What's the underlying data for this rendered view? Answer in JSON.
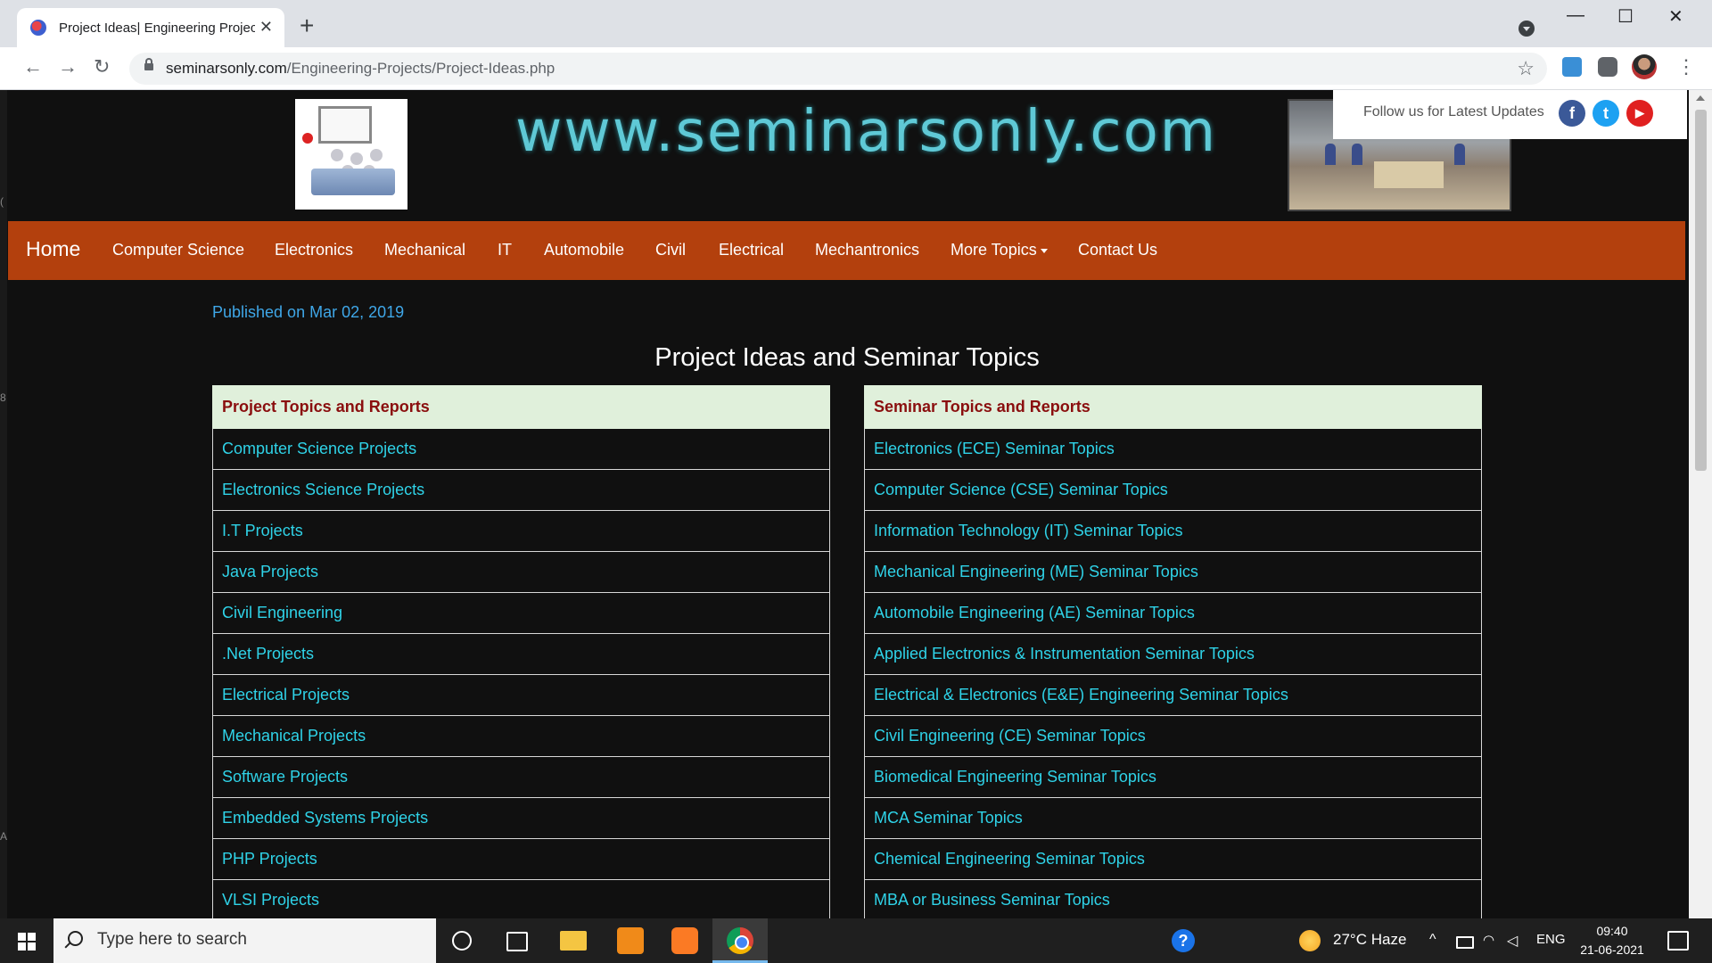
{
  "browser": {
    "tab_title": "Project Ideas| Engineering Projec",
    "new_tab": "+",
    "close_tab": "✕",
    "url_domain": "seminarsonly.com",
    "url_path": "/Engineering-Projects/Project-Ideas.php",
    "back": "←",
    "forward": "→",
    "reload": "↻",
    "star": "☆",
    "menu": "⋮",
    "minimize": "—",
    "maximize": "☐",
    "close": "✕"
  },
  "header": {
    "site_name": "www.seminarsonly.com",
    "follow_text": "Follow us for Latest Updates",
    "social": {
      "facebook": "f",
      "twitter": "t",
      "youtube": "▶"
    }
  },
  "nav": {
    "items": [
      "Home",
      "Computer Science",
      "Electronics",
      "Mechanical",
      "IT",
      "Automobile",
      "Civil",
      "Electrical",
      "Mechantronics",
      "More Topics",
      "Contact Us"
    ]
  },
  "content": {
    "published": "Published on Mar 02, 2019",
    "heading": "Project Ideas and Seminar Topics",
    "projects": {
      "header": "Project Topics and Reports",
      "items": [
        "Computer Science Projects",
        "Electronics Science Projects",
        "I.T Projects",
        "Java Projects",
        "Civil Engineering",
        ".Net Projects",
        "Electrical Projects",
        "Mechanical Projects",
        "Software Projects",
        "Embedded Systems Projects",
        "PHP Projects",
        "VLSI Projects"
      ]
    },
    "seminars": {
      "header": "Seminar Topics and Reports",
      "items": [
        "Electronics (ECE) Seminar Topics",
        "Computer Science (CSE) Seminar Topics",
        "Information Technology (IT) Seminar Topics",
        "Mechanical Engineering (ME) Seminar Topics",
        "Automobile Engineering (AE) Seminar Topics",
        "Applied Electronics & Instrumentation Seminar Topics",
        "Electrical & Electronics (E&E) Engineering Seminar Topics",
        "Civil Engineering (CE) Seminar Topics",
        "Biomedical Engineering Seminar Topics",
        "MCA Seminar Topics",
        "Chemical Engineering Seminar Topics",
        "MBA or Business Seminar Topics"
      ]
    }
  },
  "edge_glyphs": [
    "(",
    "8",
    "A"
  ],
  "taskbar": {
    "search_placeholder": "Type here to search",
    "weather": "27°C  Haze",
    "tray": {
      "chevron": "^",
      "lang": "ENG"
    },
    "time": "09:40",
    "date": "21-06-2021",
    "help": "?"
  },
  "colors": {
    "nav_bg": "#b3400d",
    "link": "#2fd3e8",
    "table_header_bg": "#e0f0db",
    "table_header_text": "#8a0e0e",
    "published_text": "#3fa7e8",
    "site_name": "#5fc9d6"
  }
}
